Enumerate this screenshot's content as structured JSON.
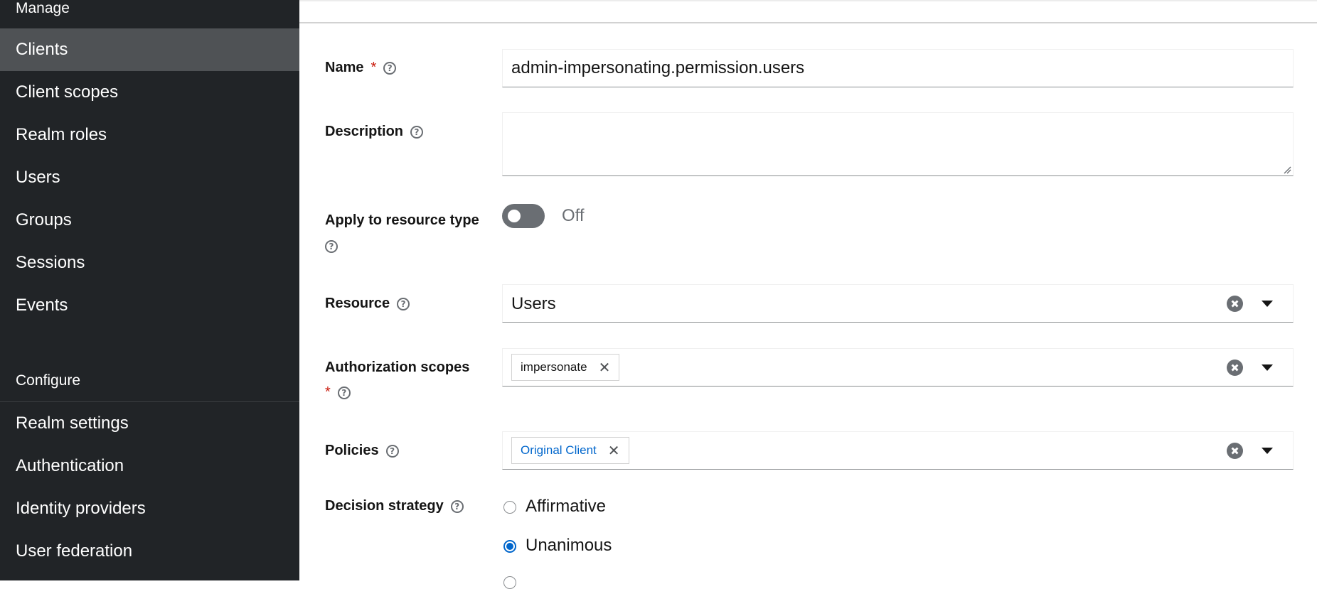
{
  "sidebar": {
    "manage_heading": "Manage",
    "manage_items": [
      {
        "label": "Clients",
        "active": true
      },
      {
        "label": "Client scopes"
      },
      {
        "label": "Realm roles"
      },
      {
        "label": "Users"
      },
      {
        "label": "Groups"
      },
      {
        "label": "Sessions"
      },
      {
        "label": "Events"
      }
    ],
    "configure_heading": "Configure",
    "configure_items": [
      {
        "label": "Realm settings"
      },
      {
        "label": "Authentication"
      },
      {
        "label": "Identity providers"
      },
      {
        "label": "User federation"
      }
    ]
  },
  "form": {
    "name": {
      "label": "Name",
      "required_mark": "*",
      "value": "admin-impersonating.permission.users"
    },
    "description": {
      "label": "Description",
      "value": ""
    },
    "apply_resource_type": {
      "label": "Apply to resource type",
      "state_text": "Off",
      "checked": false
    },
    "resource": {
      "label": "Resource",
      "value": "Users"
    },
    "authorization_scopes": {
      "label": "Authorization scopes",
      "required_mark": "*",
      "chips": [
        "impersonate"
      ]
    },
    "policies": {
      "label": "Policies",
      "chips": [
        "Original Client"
      ]
    },
    "decision_strategy": {
      "label": "Decision strategy",
      "options": [
        {
          "label": "Affirmative",
          "checked": false
        },
        {
          "label": "Unanimous",
          "checked": true
        }
      ]
    }
  },
  "icons": {
    "help": "question-circle-icon",
    "clear": "times-circle-icon",
    "caret": "caret-down-icon",
    "chip_remove": "times-icon"
  },
  "colors": {
    "sidebar_bg": "#212427",
    "sidebar_active": "#4f5255",
    "required": "#c9190b",
    "link_blue": "#0066cc"
  }
}
